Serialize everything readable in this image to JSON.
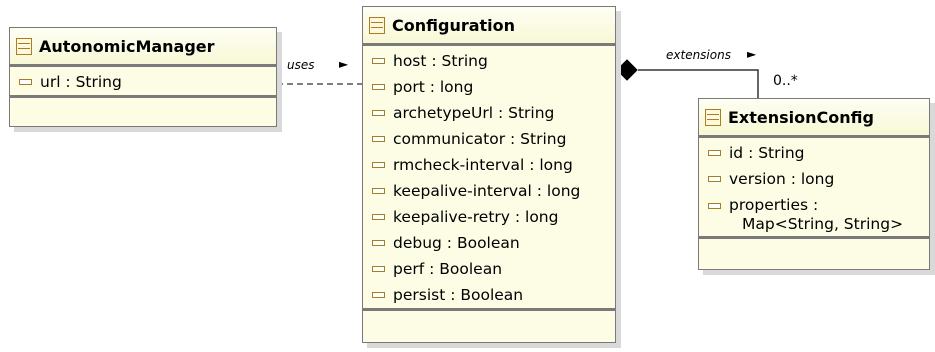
{
  "classes": {
    "autonomic_manager": {
      "name": "AutonomicManager",
      "attributes": [
        "url : String"
      ]
    },
    "configuration": {
      "name": "Configuration",
      "attributes": [
        "host : String",
        "port : long",
        "archetypeUrl : String",
        "communicator : String",
        "rmcheck-interval : long",
        "keepalive-interval : long",
        "keepalive-retry : long",
        "debug : Boolean",
        "perf : Boolean",
        "persist : Boolean"
      ]
    },
    "extension_config": {
      "name": "ExtensionConfig",
      "attributes": [
        "id : String",
        "version : long"
      ],
      "properties_attr": [
        "properties :",
        "Map<String, String>"
      ]
    }
  },
  "relations": {
    "uses": {
      "label": "uses",
      "arrow": "►"
    },
    "extensions": {
      "label": "extensions",
      "arrow": "►",
      "multiplicity": "0..*"
    }
  }
}
